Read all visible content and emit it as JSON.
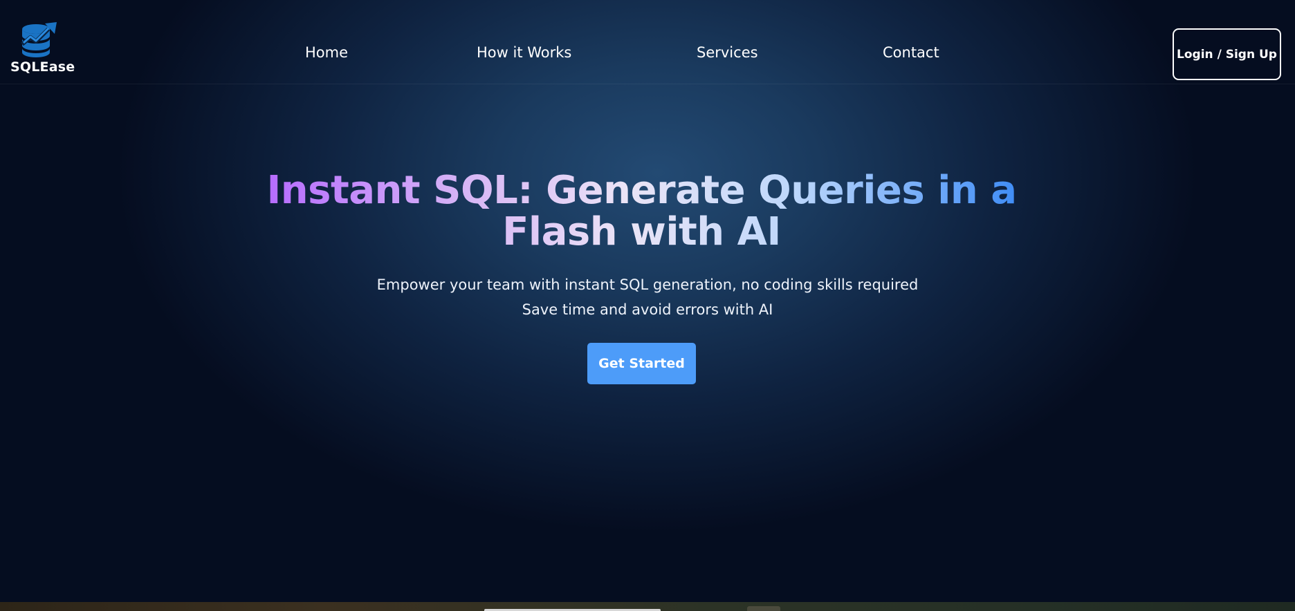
{
  "brand": {
    "name": "SQLEase",
    "logo_icon": "database-chart-icon",
    "logo_color": "#1a73c4"
  },
  "nav": {
    "items": [
      {
        "label": "Home"
      },
      {
        "label": "How it Works"
      },
      {
        "label": "Services"
      },
      {
        "label": "Contact"
      }
    ],
    "login_label": "Login / Sign Up"
  },
  "hero": {
    "title": "Instant SQL: Generate Queries in a Flash with AI",
    "subtitle_line_1": "Empower your team with instant SQL generation, no coding skills required",
    "subtitle_line_2": "Save time and avoid errors with AI",
    "cta_label": "Get Started"
  },
  "colors": {
    "background_center": "#234a73",
    "background_edge": "#050d20",
    "accent": "#4d9cf9",
    "title_gradient_start": "#b56aff",
    "title_gradient_end": "#3e8cf6"
  }
}
